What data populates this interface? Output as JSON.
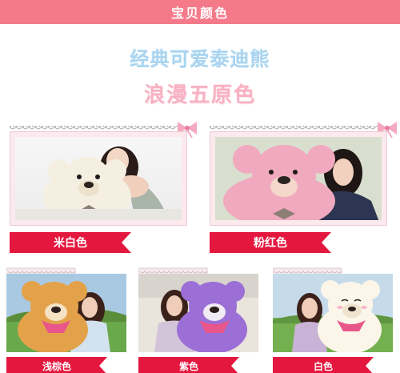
{
  "header": {
    "title": "宝贝颜色"
  },
  "slogan": {
    "line1": "经典可爱泰迪熊",
    "line2": "浪漫五原色"
  },
  "colors": [
    {
      "label": "米白色",
      "bear_color": "#f4efe0"
    },
    {
      "label": "粉红色",
      "bear_color": "#f1a9bf"
    },
    {
      "label": "浅棕色",
      "bear_color": "#e3a24a"
    },
    {
      "label": "紫色",
      "bear_color": "#9b6fd6"
    },
    {
      "label": "白色",
      "bear_color": "#fbf6e9"
    }
  ],
  "theme": {
    "accent": "#e4173f",
    "header": "#f47a8a"
  }
}
